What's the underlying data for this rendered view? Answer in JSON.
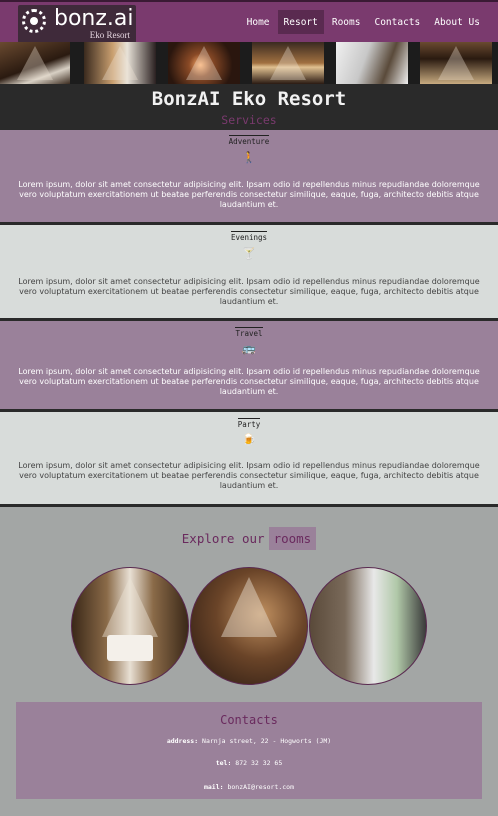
{
  "header": {
    "logo_name": "bonz.ai",
    "logo_sub": "Eko Resort",
    "nav": [
      {
        "label": "Home",
        "active": false
      },
      {
        "label": "Resort",
        "active": true
      },
      {
        "label": "Rooms",
        "active": false
      },
      {
        "label": "Contacts",
        "active": false
      },
      {
        "label": "About Us",
        "active": false
      }
    ]
  },
  "hero": {
    "title": "BonzAI Eko Resort",
    "subtitle": "Services"
  },
  "services": [
    {
      "title": "Adventure",
      "icon": "person-walking-icon",
      "glyph": "🚶",
      "text": "Lorem ipsum, dolor sit amet consectetur adipisicing elit. Ipsam odio id repellendus minus repudiandae doloremque vero voluptatum exercitationem ut beatae perferendis consectetur similique, eaque, fuga, architecto debitis atque laudantium et."
    },
    {
      "title": "Evenings",
      "icon": "cocktail-icon",
      "glyph": "🍸",
      "text": "Lorem ipsum, dolor sit amet consectetur adipisicing elit. Ipsam odio id repellendus minus repudiandae doloremque vero voluptatum exercitationem ut beatae perferendis consectetur similique, eaque, fuga, architecto debitis atque laudantium et."
    },
    {
      "title": "Travel",
      "icon": "bus-icon",
      "glyph": "🚌",
      "text": "Lorem ipsum, dolor sit amet consectetur adipisicing elit. Ipsam odio id repellendus minus repudiandae doloremque vero voluptatum exercitationem ut beatae perferendis consectetur similique, eaque, fuga, architecto debitis atque laudantium et."
    },
    {
      "title": "Party",
      "icon": "beer-mug-icon",
      "glyph": "🍺",
      "text": "Lorem ipsum, dolor sit amet consectetur adipisicing elit. Ipsam odio id repellendus minus repudiandae doloremque vero voluptatum exercitationem ut beatae perferendis consectetur similique, eaque, fuga, architecto debitis atque laudantium et."
    }
  ],
  "explore": {
    "prefix": "Explore our",
    "highlight": "rooms"
  },
  "contacts": {
    "title": "Contacts",
    "address_label": "address:",
    "address": "Narnja street, 22 - Hogworts (JM)",
    "tel_label": "tel:",
    "tel": "872 32 32 65",
    "mail_label": "mail:",
    "mail": "bonzAI@resort.com"
  },
  "colors": {
    "header": "#7a3a6e",
    "accent": "#6a2a5e",
    "service_purple": "#9a819a",
    "service_light": "#d8dcda",
    "icon": "#4a6ad8"
  }
}
